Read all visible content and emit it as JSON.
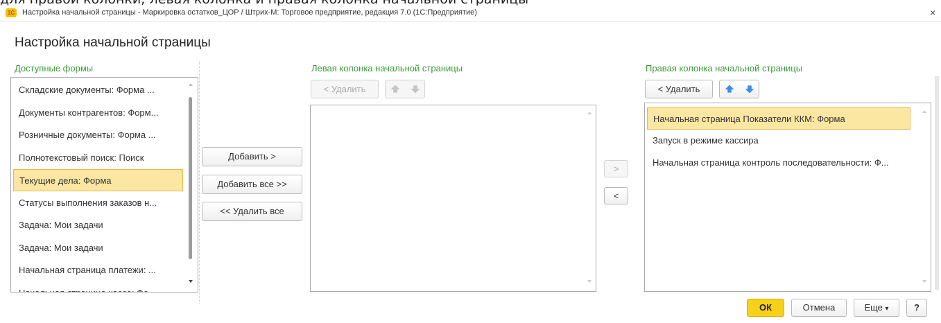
{
  "top_caption": "для правой колонки; левая колонка и правая колонка начальной страницы",
  "window": {
    "logo": "1С",
    "title": "Настройка начальной страницы - Маркировка остатков_ЦОР / Штрих-М: Торговое предприятие, редакция 7.0  (1С:Предприятие)",
    "close": "×"
  },
  "page_title": "Настройка начальной страницы",
  "available": {
    "title": "Доступные формы",
    "items": [
      "Складские документы: Форма ...",
      "Документы контрагентов: Форм...",
      "Розничные документы: Форма ...",
      "Полнотекстовый поиск: Поиск",
      "Текущие дела: Форма",
      "Статусы выполнения заказов н...",
      "Задача: Мои задачи",
      "Задача: Мои задачи",
      "Начальная страница платежи: ...",
      "Начальная страница касса: Фо..."
    ],
    "selected_index": 4
  },
  "middle_buttons": {
    "add": "Добавить >",
    "add_all": "Добавить все >>",
    "remove_all": "<< Удалить все"
  },
  "left_column": {
    "title": "Левая колонка начальной страницы",
    "remove": "< Удалить",
    "items": []
  },
  "move_buttons": {
    "right": ">",
    "left": "<"
  },
  "right_column": {
    "title": "Правая колонка начальной страницы",
    "remove": "< Удалить",
    "items": [
      "Начальная страница Показатели ККМ: Форма",
      "Запуск в режиме кассира",
      "Начальная страница контроль последовательности: Ф..."
    ],
    "selected_index": 0
  },
  "footer": {
    "ok": "ОК",
    "cancel": "Отмена",
    "more": "Еще",
    "more_caret": "▾",
    "help": "?"
  },
  "colors": {
    "accent_yellow": "#f7d117",
    "selection": "#fbe6a2",
    "section_title_green": "#3a9a3a",
    "arrow_blue": "#3a8ee6"
  },
  "icons": [
    "logo-icon",
    "close-icon",
    "arrow-up-icon",
    "arrow-down-icon",
    "scroll-up-icon",
    "scroll-down-icon"
  ]
}
